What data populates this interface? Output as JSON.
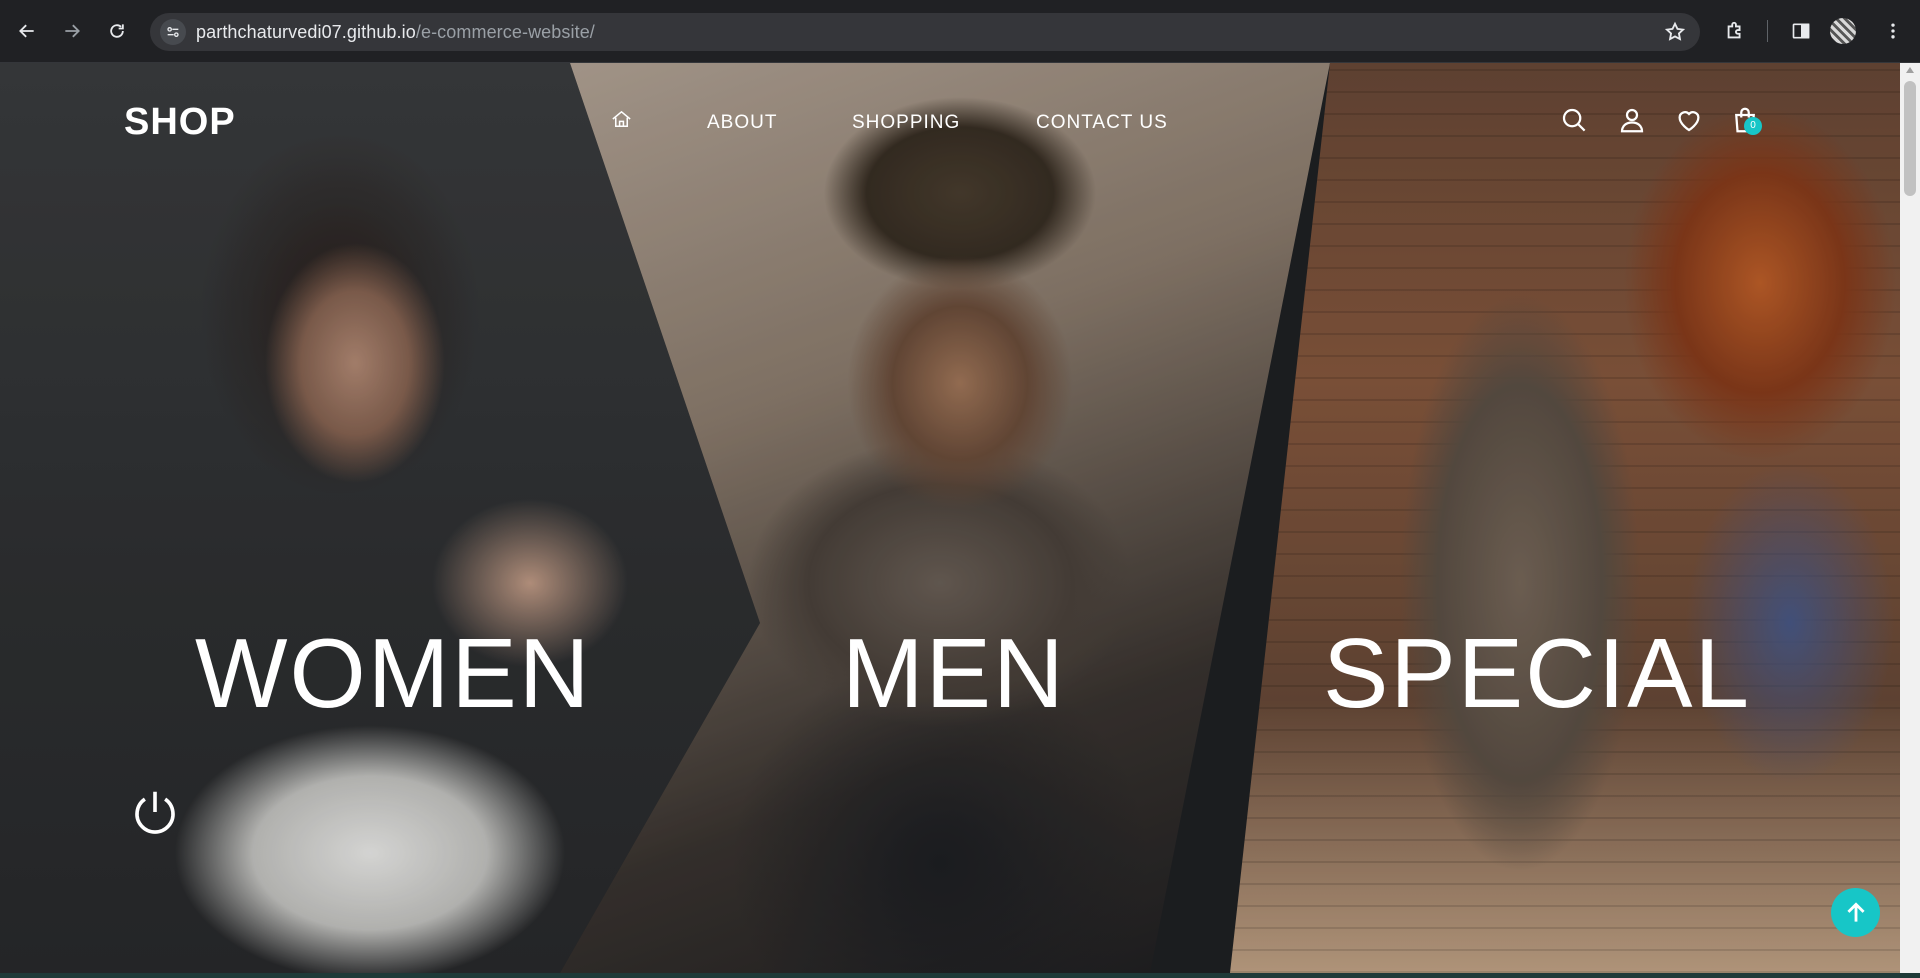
{
  "browser": {
    "url_host": "parthchaturvedi07.github.io",
    "url_path": "/e-commerce-website/"
  },
  "header": {
    "logo": "SHOP",
    "nav": [
      "ABOUT",
      "SHOPPING",
      "CONTACT US"
    ],
    "cart_count": "0"
  },
  "categories": [
    "WOMEN",
    "MEN",
    "SPECIAL"
  ],
  "colors": {
    "accent": "#17c6c7",
    "chrome_bg": "#202124"
  },
  "icons": [
    "back-icon",
    "forward-icon",
    "reload-icon",
    "site-info-icon",
    "star-icon",
    "extensions-icon",
    "side-panel-icon",
    "menu-icon",
    "home-icon",
    "search-icon",
    "user-icon",
    "heart-icon",
    "cart-icon",
    "power-icon",
    "arrow-up-icon"
  ]
}
